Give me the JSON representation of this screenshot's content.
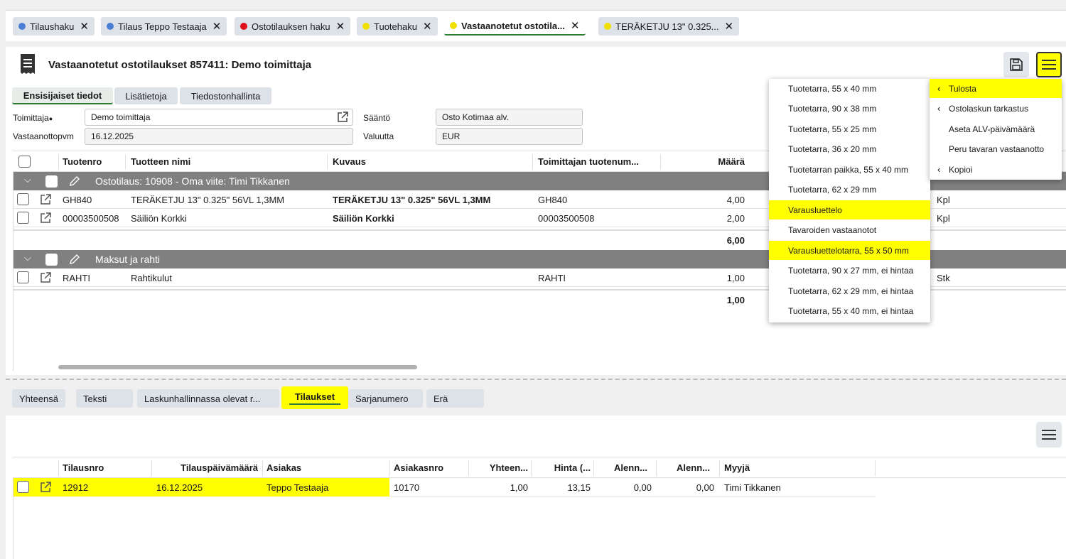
{
  "tabs": [
    {
      "label": "Tilaushaku",
      "dot": "#4a7fd4",
      "active": false
    },
    {
      "label": "Tilaus Teppo Testaaja",
      "dot": "#4a7fd4",
      "active": false
    },
    {
      "label": "Ostotilauksen haku",
      "dot": "#e0101a",
      "active": false
    },
    {
      "label": "Tuotehaku",
      "dot": "#f0e000",
      "active": false
    },
    {
      "label": "Vastaanotetut ostotila...",
      "dot": "#f0e000",
      "active": true
    },
    {
      "label": "TERÄKETJU 13\" 0.325...",
      "dot": "#f0e000",
      "active": false
    }
  ],
  "close_glyph": "✕",
  "header": {
    "title": "Vastaanotetut ostotilaukset 857411: Demo toimittaja"
  },
  "subtabs": [
    "Ensisijaiset tiedot",
    "Lisätietoja",
    "Tiedostonhallinta"
  ],
  "form": {
    "supplier_label": "Toimittaja",
    "supplier_value": "Demo toimittaja",
    "date_label": "Vastaanottopvm",
    "date_value": "16.12.2025",
    "rule_label": "Sääntö",
    "rule_value": "Osto Kotimaa alv.",
    "currency_label": "Valuutta",
    "currency_value": "EUR"
  },
  "grid": {
    "columns": [
      "Tuotenro",
      "Tuotteen nimi",
      "Kuvaus",
      "Toimittajan tuotenum...",
      "Määrä"
    ],
    "groups": [
      {
        "title": "Ostotilaus: 10908 - Oma viite: Timi Tikkanen",
        "rows": [
          {
            "tuotenro": "GH840",
            "nimi": "TERÄKETJU 13\" 0.325\" 56VL 1,3MM",
            "kuvaus": "TERÄKETJU 13\" 0.325\" 56VL 1,3MM",
            "toim": "GH840",
            "maara": "4,00",
            "yks": "Kpl"
          },
          {
            "tuotenro": "00003500508",
            "nimi": "Säiliön Korkki",
            "kuvaus": "Säiliön Korkki",
            "toim": "00003500508",
            "maara": "2,00",
            "yks": "Kpl"
          }
        ],
        "sum": "6,00"
      },
      {
        "title": "Maksut ja rahti",
        "rows": [
          {
            "tuotenro": "RAHTI",
            "nimi": "Rahtikulut",
            "kuvaus": "",
            "toim": "RAHTI",
            "maara": "1,00",
            "yks": "Stk"
          }
        ],
        "sum": "1,00"
      }
    ]
  },
  "bottom_tabs": [
    "Yhteensä",
    "Teksti",
    "Laskunhallinnassa olevat r...",
    "Tilaukset",
    "Sarjanumero",
    "Erä"
  ],
  "orders": {
    "columns": [
      "Tilausnro",
      "Tilauspäivämäärä",
      "Asiakas",
      "Asiakasnro",
      "Yhteen...",
      "Hinta (...",
      "Alenn...",
      "Alenn...",
      "Myyjä"
    ],
    "rows": [
      {
        "tilausnro": "12912",
        "pvm": "16.12.2025",
        "asiakas": "Teppo Testaaja",
        "asiakasnro": "10170",
        "yhteensa": "1,00",
        "hinta": "13,15",
        "alenn1": "0,00",
        "alenn2": "0,00",
        "myyja": "Timi Tikkanen"
      }
    ]
  },
  "menu_main": [
    {
      "label": "Tulosta",
      "chevron": true,
      "highlight": true
    },
    {
      "label": "Ostolaskun tarkastus",
      "chevron": true,
      "highlight": false
    },
    {
      "label": "Aseta ALV-päivämäärä",
      "chevron": false,
      "highlight": false
    },
    {
      "label": "Peru tavaran vastaanotto",
      "chevron": false,
      "highlight": false
    },
    {
      "label": "Kopioi",
      "chevron": true,
      "highlight": false
    }
  ],
  "menu_print": [
    {
      "label": "Tuotetarra, 55 x 40 mm",
      "highlight": false
    },
    {
      "label": "Tuotetarra, 90 x 38 mm",
      "highlight": false
    },
    {
      "label": "Tuotetarra, 55 x 25 mm",
      "highlight": false
    },
    {
      "label": "Tuotetarra, 36 x 20 mm",
      "highlight": false
    },
    {
      "label": "Tuotetarran paikka, 55 x 40 mm",
      "highlight": false
    },
    {
      "label": "Tuotetarra, 62 x 29 mm",
      "highlight": false
    },
    {
      "label": "Varausluettelo",
      "highlight": true
    },
    {
      "label": "Tavaroiden vastaanotot",
      "highlight": false
    },
    {
      "label": "Varausluettelotarra, 55 x 50 mm",
      "highlight": true
    },
    {
      "label": "Tuotetarra, 90 x 27 mm, ei hintaa",
      "highlight": false
    },
    {
      "label": "Tuotetarra, 62 x 29 mm, ei hintaa",
      "highlight": false
    },
    {
      "label": "Tuotetarra, 55 x 40 mm, ei hintaa",
      "highlight": false
    }
  ],
  "colors": {
    "highlight": "#ffff00",
    "active_underline": "#2e7d32",
    "group_bg": "#808080"
  }
}
